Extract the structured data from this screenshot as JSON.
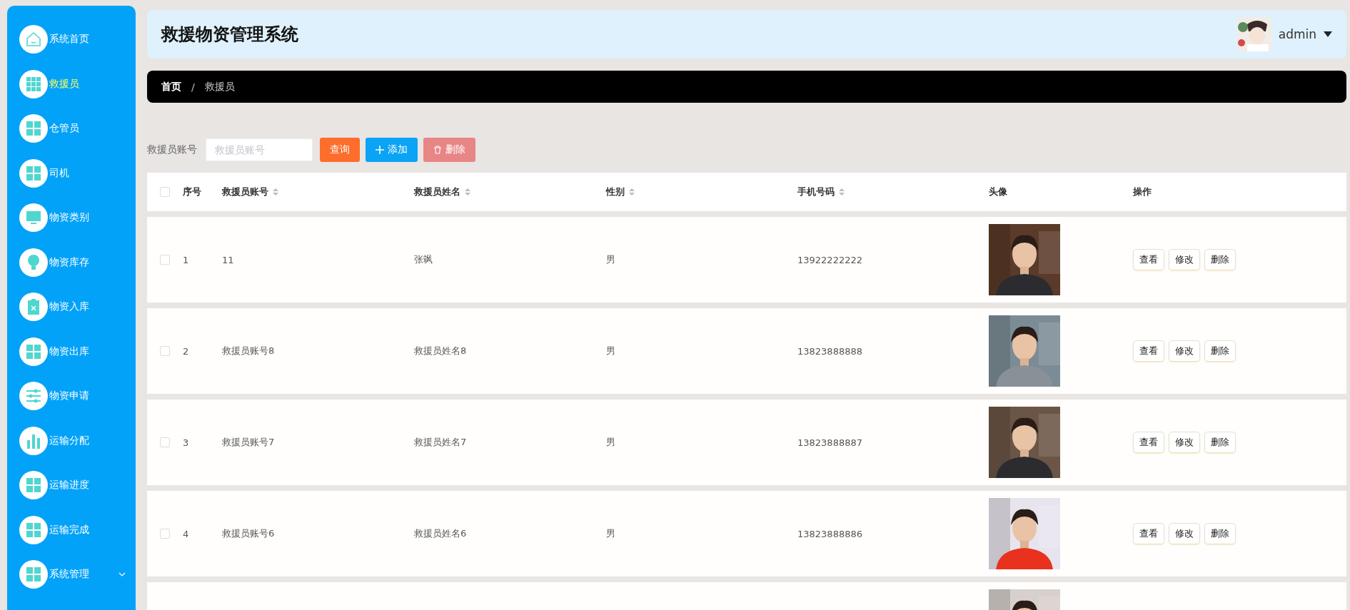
{
  "sidebar": {
    "items": [
      {
        "label": "系统首页",
        "kind": "home",
        "selected": false
      },
      {
        "label": "救援员",
        "kind": "list",
        "selected": true
      },
      {
        "label": "仓管员",
        "kind": "module",
        "selected": false
      },
      {
        "label": "司机",
        "kind": "module",
        "selected": false
      },
      {
        "label": "物资类别",
        "kind": "category",
        "selected": false
      },
      {
        "label": "物资库存",
        "kind": "stock",
        "selected": false
      },
      {
        "label": "物资入库",
        "kind": "inbound",
        "selected": false
      },
      {
        "label": "物资出库",
        "kind": "module",
        "selected": false
      },
      {
        "label": "物资申请",
        "kind": "request",
        "selected": false
      },
      {
        "label": "运输分配",
        "kind": "stats",
        "selected": false
      },
      {
        "label": "运输进度",
        "kind": "module",
        "selected": false
      },
      {
        "label": "运输完成",
        "kind": "module",
        "selected": false
      },
      {
        "label": "系统管理",
        "kind": "module",
        "selected": false,
        "expandable": true
      }
    ]
  },
  "header": {
    "title": "救援物资管理系统",
    "user": "admin"
  },
  "breadcrumb": {
    "items": [
      "首页",
      "救援员"
    ],
    "separator": "/"
  },
  "search": {
    "label": "救援员账号",
    "placeholder": "救援员账号",
    "buttons": [
      {
        "label": "查询",
        "kind": "query"
      },
      {
        "label": "添加",
        "kind": "add"
      },
      {
        "label": "删除",
        "kind": "delete"
      }
    ]
  },
  "table": {
    "select_all_checked": false,
    "columns": [
      {
        "label": "序号",
        "sortable": false
      },
      {
        "label": "救援员账号",
        "sortable": true
      },
      {
        "label": "救援员姓名",
        "sortable": true
      },
      {
        "label": "性别",
        "sortable": true
      },
      {
        "label": "手机号码",
        "sortable": true
      },
      {
        "label": "头像",
        "sortable": false
      },
      {
        "label": "操作",
        "sortable": false
      }
    ],
    "rows": [
      {
        "index": "1",
        "account": "11",
        "name": "张飒",
        "gender": "男",
        "phone": "13922222222",
        "avatar": {
          "kind": "picture"
        },
        "actions": [
          "查看",
          "修改",
          "删除"
        ],
        "checked": false
      },
      {
        "index": "2",
        "account": "救援员账号8",
        "name": "救援员姓名8",
        "gender": "男",
        "phone": "13823888888",
        "avatar": {
          "kind": "picture"
        },
        "actions": [
          "查看",
          "修改",
          "删除"
        ],
        "checked": false
      },
      {
        "index": "3",
        "account": "救援员账号7",
        "name": "救援员姓名7",
        "gender": "男",
        "phone": "13823888887",
        "avatar": {
          "kind": "picture"
        },
        "actions": [
          "查看",
          "修改",
          "删除"
        ],
        "checked": false
      },
      {
        "index": "4",
        "account": "救援员账号6",
        "name": "救援员姓名6",
        "gender": "男",
        "phone": "13823888886",
        "avatar": {
          "kind": "picture"
        },
        "actions": [
          "查看",
          "修改",
          "删除"
        ],
        "checked": false
      },
      {
        "avatar": {
          "kind": "picture"
        }
      }
    ]
  }
}
